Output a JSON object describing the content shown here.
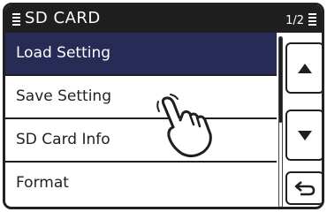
{
  "header": {
    "title": "SD CARD",
    "page_indicator": "1/2",
    "menu_icon": "list-icon"
  },
  "menu": {
    "items": [
      {
        "label": "Load Setting",
        "selected": true
      },
      {
        "label": "Save Setting",
        "selected": false
      },
      {
        "label": "SD Card Info",
        "selected": false
      },
      {
        "label": "Format",
        "selected": false
      }
    ]
  },
  "controls": {
    "up_icon": "triangle-up-icon",
    "down_icon": "triangle-down-icon",
    "back_icon": "return-arrow-icon"
  },
  "overlay": {
    "pointer_icon": "pointing-hand-icon"
  },
  "colors": {
    "titlebar": "#1f1f1f",
    "selected_row": "#272b55",
    "background": "#ffffff"
  }
}
